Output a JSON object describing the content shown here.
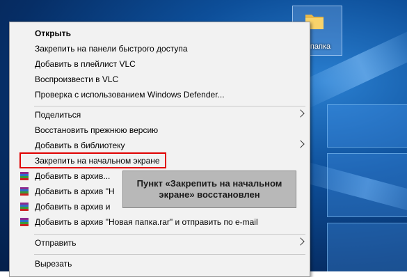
{
  "desktop": {
    "folder_label": "я папка"
  },
  "menu": {
    "items": [
      {
        "label": "Открыть",
        "bold": true
      },
      {
        "label": "Закрепить на панели быстрого доступа"
      },
      {
        "label": "Добавить в плейлист VLC"
      },
      {
        "label": "Воспроизвести в VLC"
      },
      {
        "label": "Проверка с использованием Windows Defender..."
      },
      {
        "label": "Поделиться",
        "submenu": true
      },
      {
        "label": "Восстановить прежнюю версию"
      },
      {
        "label": "Добавить в библиотеку",
        "submenu": true
      },
      {
        "label": "Закрепить на начальном экране"
      },
      {
        "label": "Добавить в архив..."
      },
      {
        "label": "Добавить в архив \"Н"
      },
      {
        "label": "Добавить в архив и"
      },
      {
        "label": "Добавить в архив \"Новая папка.rar\" и отправить по e-mail"
      },
      {
        "label": "Отправить",
        "submenu": true
      },
      {
        "label": "Вырезать"
      }
    ]
  },
  "tooltip": {
    "text": "Пункт «Закрепить на начальном экране» восстановлен"
  },
  "colors": {
    "highlight_border": "#e00000",
    "tooltip_bg": "#b8b8b8",
    "menu_bg": "#f2f2f2"
  }
}
